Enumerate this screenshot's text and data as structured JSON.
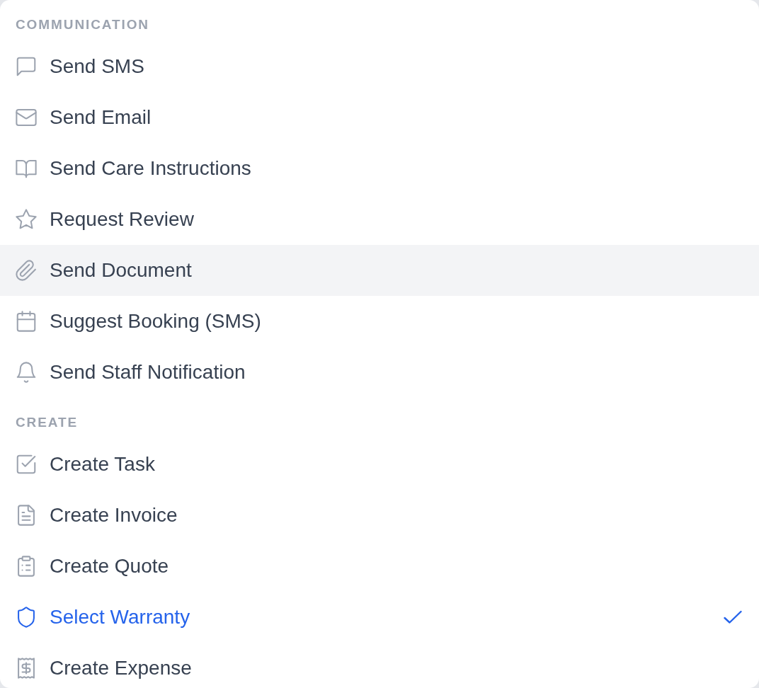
{
  "menu": {
    "sections": [
      {
        "title": "COMMUNICATION",
        "items": [
          {
            "label": "Send SMS",
            "highlighted": false,
            "selected": false
          },
          {
            "label": "Send Email",
            "highlighted": false,
            "selected": false
          },
          {
            "label": "Send Care Instructions",
            "highlighted": false,
            "selected": false
          },
          {
            "label": "Request Review",
            "highlighted": false,
            "selected": false
          },
          {
            "label": "Send Document",
            "highlighted": true,
            "selected": false
          },
          {
            "label": "Suggest Booking (SMS)",
            "highlighted": false,
            "selected": false
          },
          {
            "label": "Send Staff Notification",
            "highlighted": false,
            "selected": false
          }
        ]
      },
      {
        "title": "CREATE",
        "items": [
          {
            "label": "Create Task",
            "highlighted": false,
            "selected": false
          },
          {
            "label": "Create Invoice",
            "highlighted": false,
            "selected": false
          },
          {
            "label": "Create Quote",
            "highlighted": false,
            "selected": false
          },
          {
            "label": "Select Warranty",
            "highlighted": false,
            "selected": true
          },
          {
            "label": "Create Expense",
            "highlighted": false,
            "selected": false
          }
        ]
      }
    ]
  }
}
